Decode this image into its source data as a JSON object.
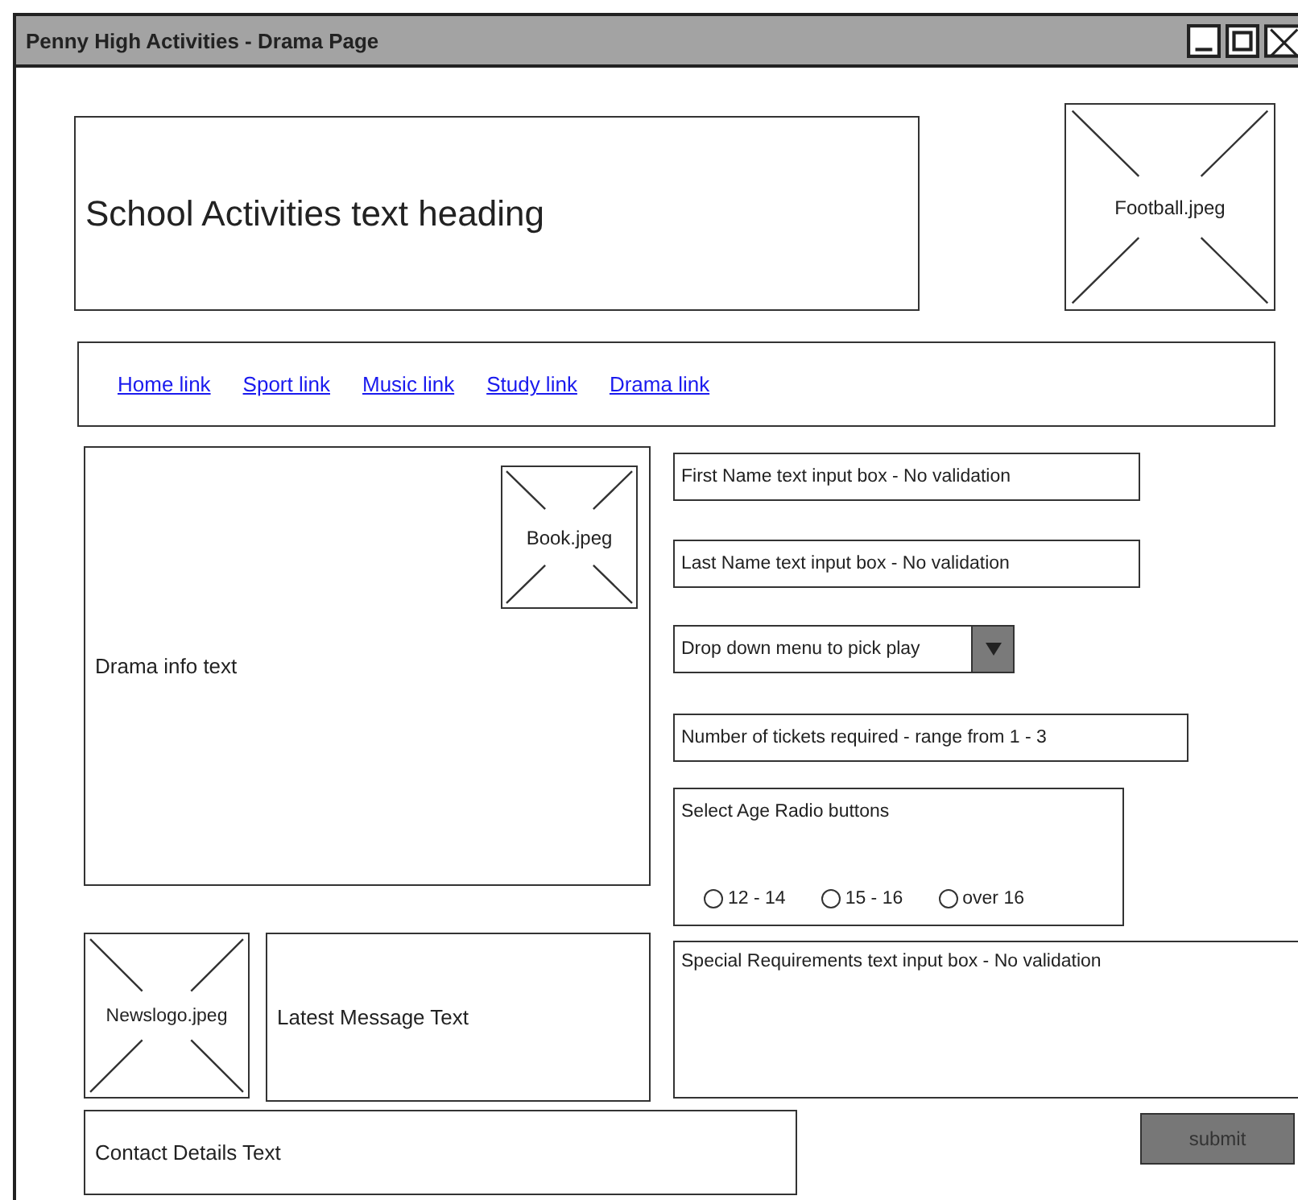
{
  "window": {
    "title": "Penny High Activities - Drama Page"
  },
  "header": {
    "heading": "School Activities text heading",
    "image": {
      "label": "Football.jpeg"
    }
  },
  "nav": {
    "links": [
      "Home link",
      "Sport link",
      "Music link",
      "Study link",
      "Drama link"
    ]
  },
  "info": {
    "text": "Drama info text",
    "image": {
      "label": "Book.jpeg"
    }
  },
  "news": {
    "image": {
      "label": "Newslogo.jpeg"
    },
    "text": "Latest Message Text"
  },
  "contact": {
    "text": "Contact Details Text"
  },
  "form": {
    "first_name": {
      "placeholder": "First Name text input box - No validation"
    },
    "last_name": {
      "placeholder": "Last Name text input box - No validation"
    },
    "dropdown": {
      "value": "Drop down menu to pick play"
    },
    "tickets": {
      "placeholder": "Number of tickets required - range from 1 - 3"
    },
    "age": {
      "label": "Select Age Radio buttons",
      "options": [
        {
          "label": "12 - 14",
          "selected": false
        },
        {
          "label": "15 - 16",
          "selected": false
        },
        {
          "label": "over 16",
          "selected": false
        }
      ]
    },
    "special": {
      "placeholder": "Special Requirements text input box - No validation"
    },
    "submit": "submit"
  }
}
